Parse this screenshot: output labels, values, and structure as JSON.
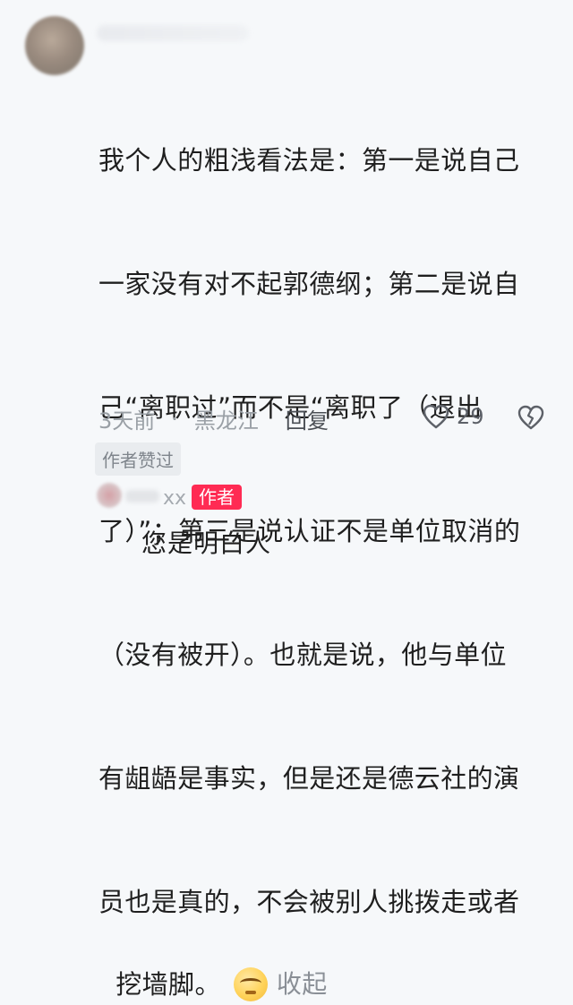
{
  "comment": {
    "lines": [
      "我个人的粗浅看法是：第一是说自己",
      "一家没有对不起郭德纲；第二是说自",
      "己“离职过”而不是“离职了（退出",
      "了）”；第三是说认证不是单位取消的",
      "（没有被开）。也就是说，他与单位",
      "有龃龉是事实，但是还是德云社的演",
      "员也是真的，不会被别人挑拨走或者"
    ],
    "last_line": "挖墙脚。",
    "emoji_icon": "smirk-emoji",
    "collapse_label": "收起"
  },
  "meta": {
    "time": "3天前",
    "separator": "·",
    "location": "黑龙江",
    "reply_label": "回复",
    "likes": "29"
  },
  "badges": {
    "author_liked": "作者赞过"
  },
  "reply": {
    "username": "xx",
    "author_badge": "作者",
    "text": "您是明白人"
  },
  "colors": {
    "background": "#f6f8fa",
    "author_badge_bg": "#ff2b53",
    "muted_text": "#9aa0a6"
  }
}
